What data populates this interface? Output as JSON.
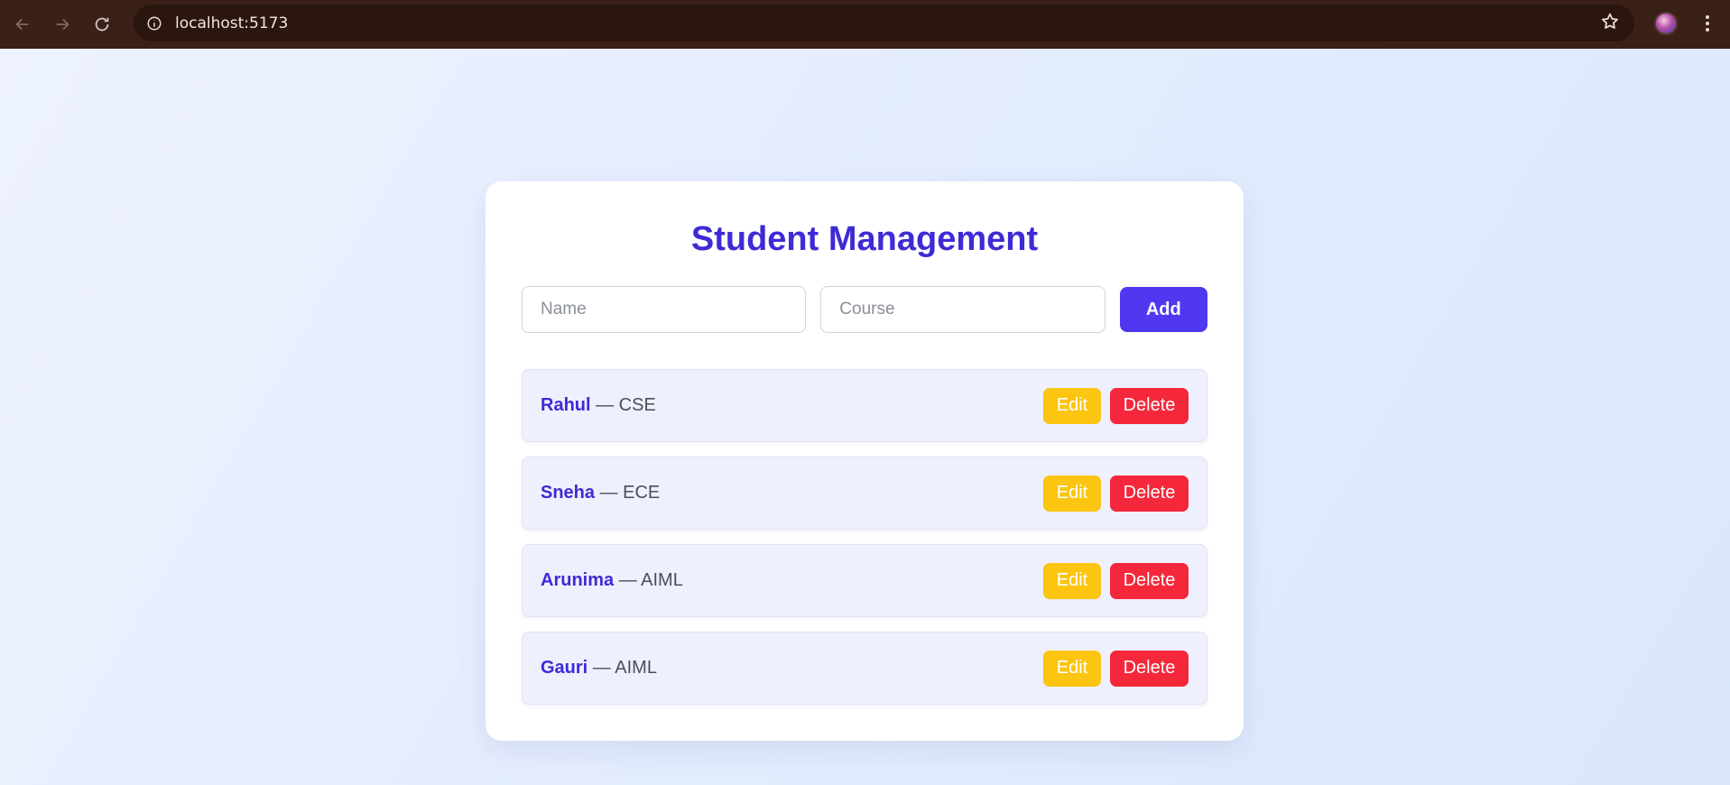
{
  "browser": {
    "url": "localhost:5173"
  },
  "app": {
    "title": "Student Management",
    "form": {
      "name_placeholder": "Name",
      "course_placeholder": "Course",
      "name_value": "",
      "course_value": "",
      "add_label": "Add"
    },
    "students": [
      {
        "name": "Rahul",
        "course": "— CSE"
      },
      {
        "name": "Sneha",
        "course": "— ECE"
      },
      {
        "name": "Arunima",
        "course": "— AIML"
      },
      {
        "name": "Gauri",
        "course": "— AIML"
      }
    ],
    "edit_label": "Edit",
    "delete_label": "Delete"
  },
  "colors": {
    "accent": "#3d2bd6",
    "add_button": "#4f38f0",
    "edit_button": "#fbc512",
    "delete_button": "#f5283b",
    "chrome": "#3a2016"
  }
}
